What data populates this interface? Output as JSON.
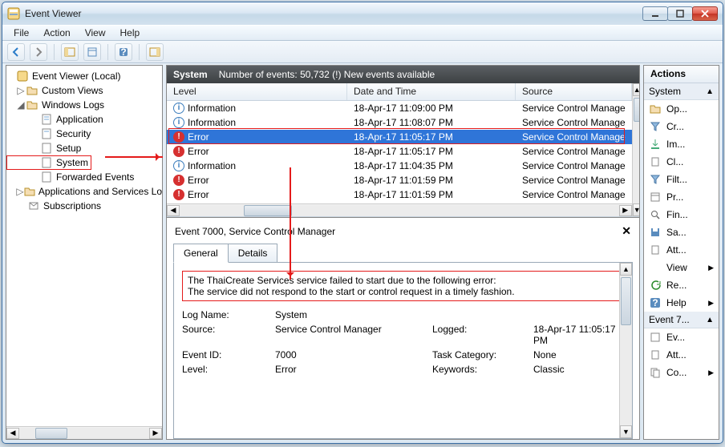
{
  "window": {
    "title": "Event Viewer"
  },
  "menu": {
    "file": "File",
    "action": "Action",
    "view": "View",
    "help": "Help"
  },
  "tree": {
    "root": "Event Viewer (Local)",
    "custom_views": "Custom Views",
    "windows_logs": "Windows Logs",
    "application": "Application",
    "security": "Security",
    "setup": "Setup",
    "system": "System",
    "forwarded": "Forwarded Events",
    "apps_services": "Applications and Services Lo",
    "subscriptions": "Subscriptions"
  },
  "section": {
    "name": "System",
    "count_label": "Number of events: 50,732 (!) New events available"
  },
  "grid": {
    "cols": {
      "level": "Level",
      "date": "Date and Time",
      "source": "Source"
    },
    "rows": [
      {
        "level": "Information",
        "type": "info",
        "date": "18-Apr-17 11:09:00 PM",
        "source": "Service Control Manage"
      },
      {
        "level": "Information",
        "type": "info",
        "date": "18-Apr-17 11:08:07 PM",
        "source": "Service Control Manage"
      },
      {
        "level": "Error",
        "type": "error",
        "date": "18-Apr-17 11:05:17 PM",
        "source": "Service Control Manage",
        "selected": true
      },
      {
        "level": "Error",
        "type": "error",
        "date": "18-Apr-17 11:05:17 PM",
        "source": "Service Control Manage"
      },
      {
        "level": "Information",
        "type": "info",
        "date": "18-Apr-17 11:04:35 PM",
        "source": "Service Control Manage"
      },
      {
        "level": "Error",
        "type": "error",
        "date": "18-Apr-17 11:01:59 PM",
        "source": "Service Control Manage"
      },
      {
        "level": "Error",
        "type": "error",
        "date": "18-Apr-17 11:01:59 PM",
        "source": "Service Control Manage"
      }
    ]
  },
  "detail": {
    "title": "Event 7000, Service Control Manager",
    "tabs": {
      "general": "General",
      "details": "Details"
    },
    "error_line1": "The ThaiCreate Services service failed to start due to the following error:",
    "error_line2": "The service did not respond to the start or control request in a timely fashion.",
    "kv": {
      "log_name_k": "Log Name:",
      "log_name_v": "System",
      "source_k": "Source:",
      "source_v": "Service Control Manager",
      "logged_k": "Logged:",
      "logged_v": "18-Apr-17 11:05:17 PM",
      "event_id_k": "Event ID:",
      "event_id_v": "7000",
      "task_cat_k": "Task Category:",
      "task_cat_v": "None",
      "level_k": "Level:",
      "level_v": "Error",
      "keywords_k": "Keywords:",
      "keywords_v": "Classic"
    }
  },
  "actions": {
    "title": "Actions",
    "group1": "System",
    "items1": [
      {
        "label": "Op...",
        "icon": "folder-open-icon"
      },
      {
        "label": "Cr...",
        "icon": "filter-create-icon"
      },
      {
        "label": "Im...",
        "icon": "import-icon"
      },
      {
        "label": "Cl...",
        "icon": "clear-icon"
      },
      {
        "label": "Filt...",
        "icon": "filter-icon"
      },
      {
        "label": "Pr...",
        "icon": "properties-icon"
      },
      {
        "label": "Fin...",
        "icon": "find-icon"
      },
      {
        "label": "Sa...",
        "icon": "save-icon"
      },
      {
        "label": "Att...",
        "icon": "attach-icon"
      },
      {
        "label": "View",
        "icon": "view-icon",
        "submenu": true
      },
      {
        "label": "Re...",
        "icon": "refresh-icon"
      },
      {
        "label": "Help",
        "icon": "help-icon",
        "submenu": true
      }
    ],
    "group2": "Event 7...",
    "items2": [
      {
        "label": "Ev...",
        "icon": "event-properties-icon"
      },
      {
        "label": "Att...",
        "icon": "attach-icon"
      },
      {
        "label": "Co...",
        "icon": "copy-icon",
        "submenu": true
      }
    ]
  }
}
